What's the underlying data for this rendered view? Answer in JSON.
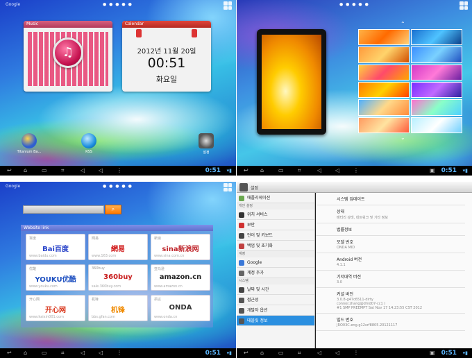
{
  "status": {
    "google_label": "Google",
    "time": "0:51"
  },
  "home": {
    "music_title": "Music",
    "calendar_title": "Calendar",
    "calendar_date": "2012년 11월 20일",
    "calendar_time": "00:51",
    "calendar_weekday": "화요일",
    "icons": [
      {
        "label": "Titanium Ba...",
        "color": "#2f5fd0"
      },
      {
        "label": "RSS",
        "color": "#1c8fe0"
      },
      {
        "label": "설정",
        "color": "#555555"
      }
    ]
  },
  "browser": {
    "panel_title": "Website link",
    "sites": [
      {
        "name": "百度",
        "logo": "Bai百度",
        "url": "www.baidu.com",
        "color": "#2540c8"
      },
      {
        "name": "网易",
        "logo": "網易",
        "url": "www.163.com",
        "color": "#d01a1a"
      },
      {
        "name": "新浪",
        "logo": "sina新浪网",
        "url": "www.sina.com.cn",
        "color": "#c0272d"
      },
      {
        "name": "优酷",
        "logo": "YOUKU优酷",
        "url": "www.youku.com",
        "color": "#1d4fc0"
      },
      {
        "name": "360buy",
        "logo": "360buy",
        "url": "sale.360buy.com",
        "color": "#c81c1c"
      },
      {
        "name": "亚马逊",
        "logo": "amazon.cn",
        "url": "www.amazon.cn",
        "color": "#222222"
      },
      {
        "name": "开心网",
        "logo": "开心网",
        "url": "www.kaixin001.com",
        "color": "#d9361b"
      },
      {
        "name": "机锋",
        "logo": "机锋",
        "url": "bbs.gfan.com",
        "color": "#f08a00"
      },
      {
        "name": "昂达",
        "logo": "ONDA",
        "url": "www.onda.cn",
        "color": "#333333"
      }
    ]
  },
  "settings": {
    "title": "설정",
    "left": [
      {
        "type": "item",
        "label": "애플리케이션",
        "color": "#6aa84f"
      },
      {
        "type": "cat",
        "label": "개인 설정"
      },
      {
        "type": "item",
        "label": "위치 서비스",
        "color": "#333333"
      },
      {
        "type": "item",
        "label": "보안",
        "color": "#d03030"
      },
      {
        "type": "item",
        "label": "언어 및 키보드",
        "color": "#444444"
      },
      {
        "type": "item",
        "label": "백업 및 초기화",
        "color": "#c04040"
      },
      {
        "type": "cat",
        "label": "계정"
      },
      {
        "type": "item",
        "label": "Google",
        "color": "#3a78d8"
      },
      {
        "type": "item",
        "label": "계정 추가",
        "color": "#666666"
      },
      {
        "type": "cat",
        "label": "시스템"
      },
      {
        "type": "item",
        "label": "날짜 및 시간",
        "color": "#444444"
      },
      {
        "type": "item",
        "label": "접근성",
        "color": "#555555"
      },
      {
        "type": "item",
        "label": "개발자 옵션",
        "color": "#555555"
      },
      {
        "type": "item",
        "label": "태블릿 정보",
        "color": "#555555",
        "selected": true
      }
    ],
    "right": [
      {
        "a": "시스템 업데이트",
        "b": ""
      },
      {
        "a": "상태",
        "b": "배터리 상태, 네트워크 및 기타 정보"
      },
      {
        "a": "법률정보",
        "b": ""
      },
      {
        "a": "모델 번호",
        "b": "ONDA MID"
      },
      {
        "a": "Android 버전",
        "b": "4.1.1"
      },
      {
        "a": "기저대역 버전",
        "b": "3.0"
      },
      {
        "a": "커널 버전",
        "b": "3.0.8-g47c6511-dirty\nconnor.zhang@dmd07-cc1 )\n#1 SMP PREEMPT Sat Nov 17 14:23:55 CST 2012"
      },
      {
        "a": "빌드 번호",
        "b": "JRO03C.eng.g12xrf8805.20121117"
      }
    ]
  }
}
